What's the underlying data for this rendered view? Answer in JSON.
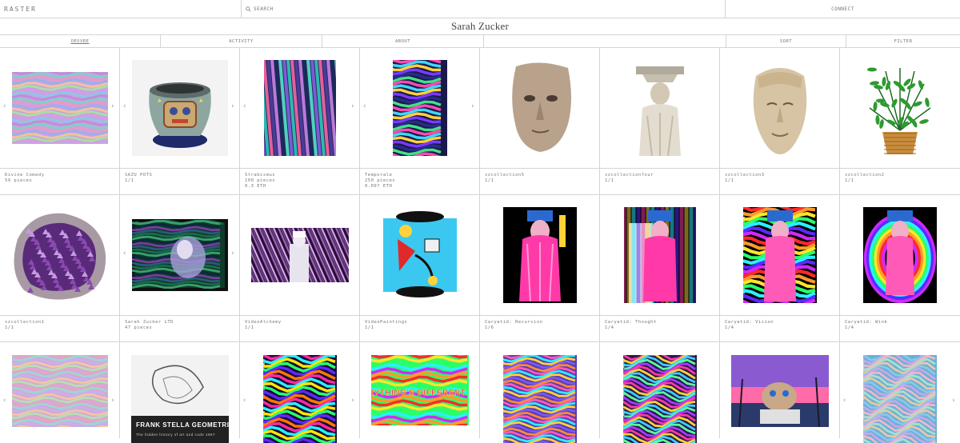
{
  "header": {
    "logo": "RASTER",
    "search_label": "SEARCH",
    "connect_label": "CONNECT"
  },
  "profile": {
    "name": "Sarah Zucker"
  },
  "tabs": [
    {
      "label": "OEUVRE",
      "active": true
    },
    {
      "label": "ACTIVITY",
      "active": false
    },
    {
      "label": "ABOUT",
      "active": false
    }
  ],
  "controls": {
    "sort_label": "SORT",
    "filter_label": "FILTER"
  },
  "collections": [
    {
      "title": "Divine Comedy",
      "line2": "59 pieces",
      "line3": "",
      "art": "psy-square",
      "carousel": true
    },
    {
      "title": "SAZU POTS",
      "line2": "1/1",
      "line3": "",
      "art": "pot",
      "carousel": true
    },
    {
      "title": "Strabismus",
      "line2": "100 pieces",
      "line3": "0.3 ETH",
      "art": "stripes-tall",
      "carousel": true
    },
    {
      "title": "Temporale",
      "line2": "250 pieces",
      "line3": "0.097 ETH",
      "art": "glitch-tall",
      "carousel": true
    },
    {
      "title": "szcollection5",
      "line2": "1/1",
      "line3": "",
      "art": "face-bust",
      "carousel": false
    },
    {
      "title": "szcollectionfour",
      "line2": "1/1",
      "line3": "",
      "art": "caryatid-statue",
      "carousel": false
    },
    {
      "title": "szcollection3",
      "line2": "1/1",
      "line3": "",
      "art": "stone-head",
      "carousel": false
    },
    {
      "title": "szcollection2",
      "line2": "1/1",
      "line3": "",
      "art": "plant",
      "carousel": false
    },
    {
      "title": "szcollection1",
      "line2": "1/1",
      "line3": "",
      "art": "amethyst",
      "carousel": false
    },
    {
      "title": "Sarah Zucker LTD",
      "line2": "47 pieces",
      "line3": "",
      "art": "crt",
      "carousel": true
    },
    {
      "title": "VideoAlchemy",
      "line2": "1/1",
      "line3": "",
      "art": "video-figure",
      "carousel": false
    },
    {
      "title": "VideoPaintings",
      "line2": "1/1",
      "line3": "",
      "art": "cartoon",
      "carousel": false
    },
    {
      "title": "Caryatid: Recursion",
      "line2": "1/6",
      "line3": "",
      "art": "caryatid-pink",
      "carousel": false
    },
    {
      "title": "Caryatid: Thought",
      "line2": "1/4",
      "line3": "",
      "art": "caryatid-tower",
      "carousel": false
    },
    {
      "title": "Caryatid: Vision",
      "line2": "1/4",
      "line3": "",
      "art": "caryatid-rainbow",
      "carousel": false
    },
    {
      "title": "Caryatid: Wink",
      "line2": "1/4",
      "line3": "",
      "art": "caryatid-ring",
      "carousel": false
    },
    {
      "title": "",
      "line2": "",
      "line3": "",
      "art": "psy-square-2",
      "carousel": true
    },
    {
      "title": "",
      "line2": "",
      "line3": "",
      "art": "poster",
      "carousel": false
    },
    {
      "title": "",
      "line2": "",
      "line3": "",
      "art": "kaleido",
      "carousel": true
    },
    {
      "title": "",
      "line2": "",
      "line3": "",
      "art": "everything-different",
      "carousel": false
    },
    {
      "title": "",
      "line2": "",
      "line3": "",
      "art": "wave-tall",
      "carousel": false
    },
    {
      "title": "",
      "line2": "",
      "line3": "",
      "art": "wave-tall-2",
      "carousel": false
    },
    {
      "title": "",
      "line2": "",
      "line3": "",
      "art": "cat-palms",
      "carousel": false
    },
    {
      "title": "",
      "line2": "",
      "line3": "",
      "art": "gradient-tall",
      "carousel": true
    }
  ],
  "poster_text": {
    "headline": "FRANK STELLA GEOMETRIES",
    "subline": "The hidden history of art and code 1967"
  },
  "artwork_text": {
    "everything_different": "EVERYTHING'S DIFFERENT NOW"
  },
  "icons": {
    "arrow_left": "‹",
    "arrow_right": "›"
  }
}
